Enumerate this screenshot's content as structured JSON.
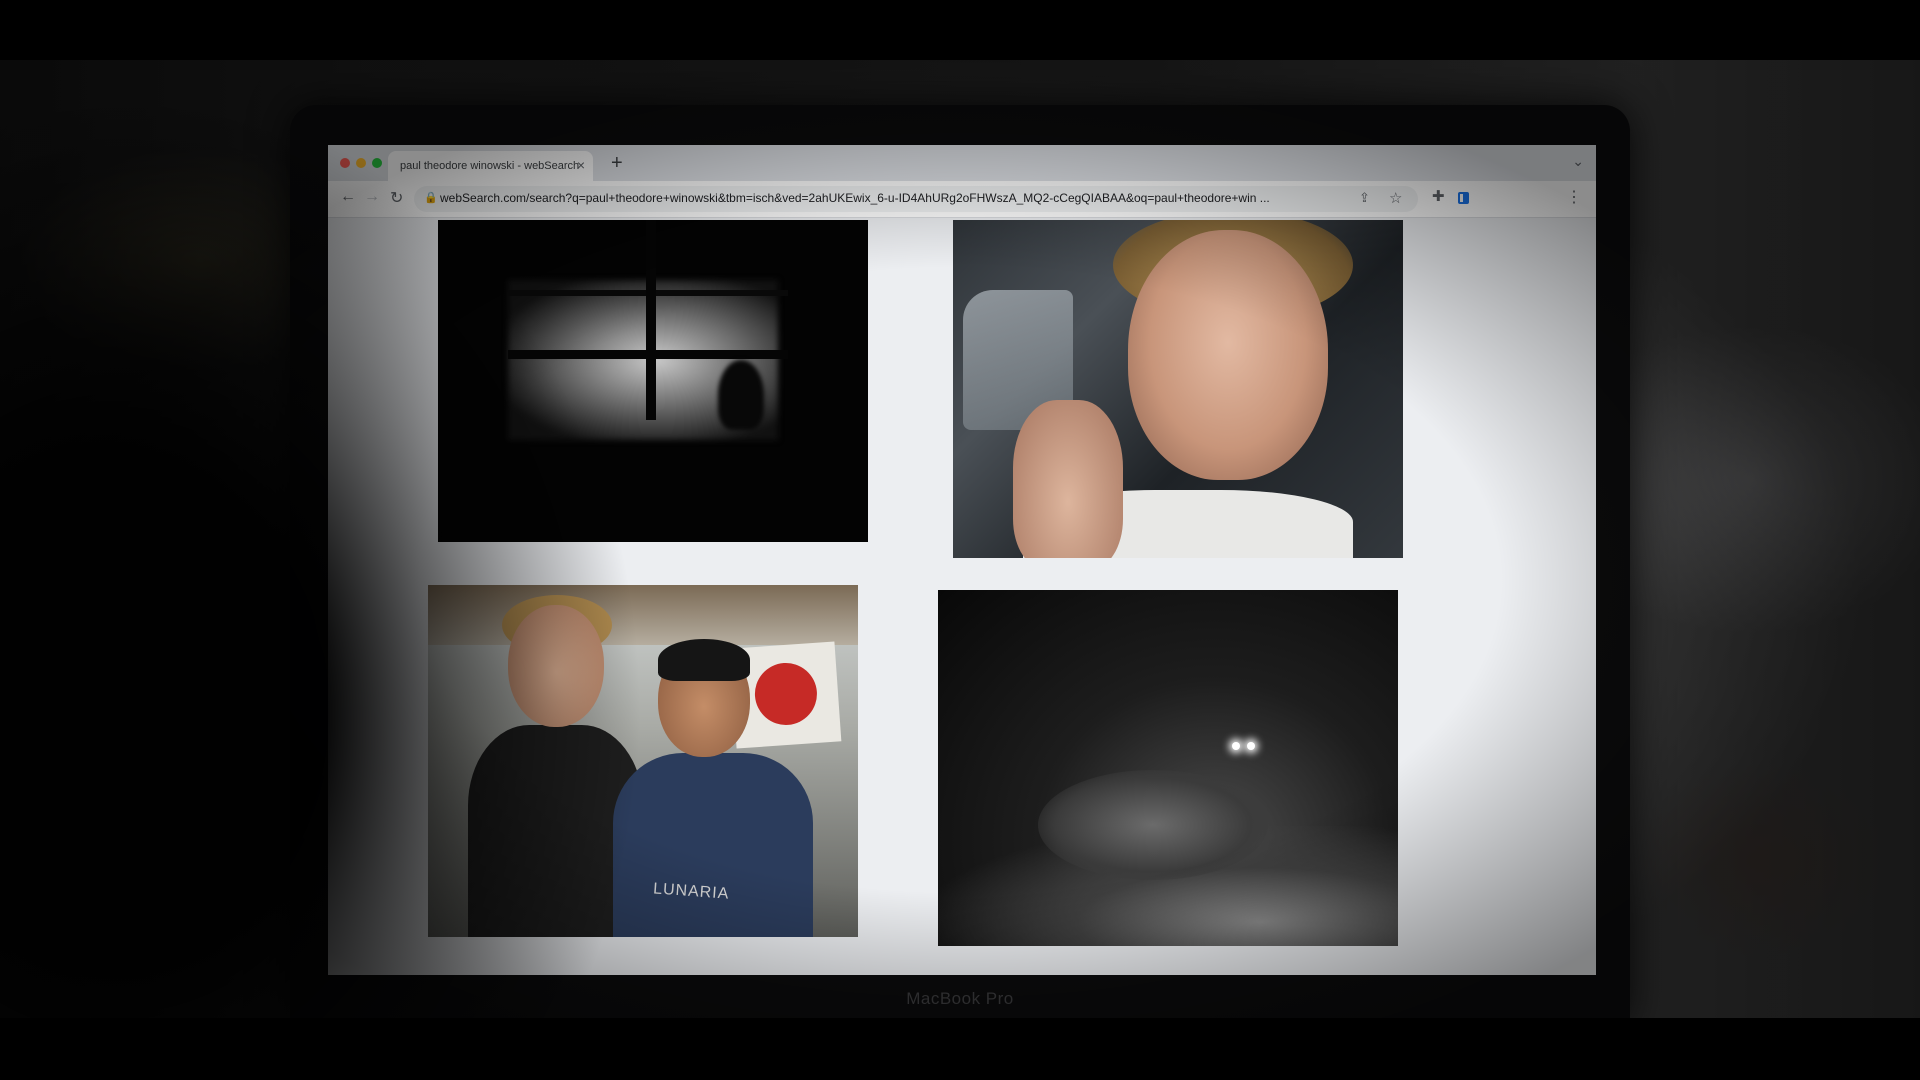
{
  "browser": {
    "tab_title": "paul theodore winowski - webSearch",
    "tab_close": "×",
    "new_tab": "+",
    "url": "webSearch.com/search?q=paul+theodore+winowski&tbm=isch&ved=2ahUKEwix_6-u-ID4AhURg2oFHWszA_MQ2-cCegQIABAA&oq=paul+theodore+win ..."
  },
  "results": {
    "images": [
      {
        "name": "window-shadow-image"
      },
      {
        "name": "car-selfie-image"
      },
      {
        "name": "two-men-aprons-image",
        "apron_text": "LUNARIA"
      },
      {
        "name": "night-coyote-image"
      }
    ]
  },
  "device": {
    "label": "MacBook Pro"
  },
  "colors": {
    "tab_bar": "#dee1e6",
    "page_bg": "#eceef1",
    "accent": "#1a73e8"
  }
}
